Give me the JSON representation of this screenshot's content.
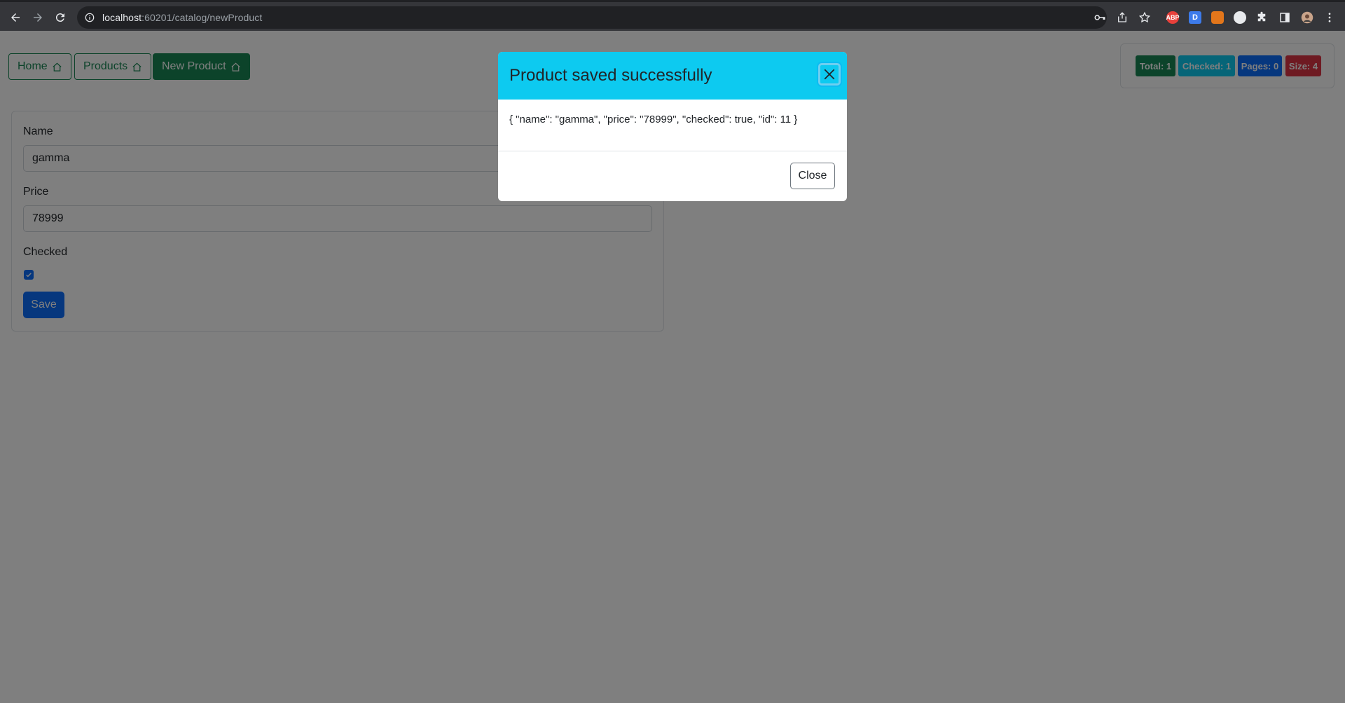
{
  "browser": {
    "url_host": "localhost",
    "url_rest": ":60201/catalog/newProduct",
    "extensions": [
      {
        "name": "abp-icon",
        "label": "ABP",
        "color": "#e8403b"
      },
      {
        "name": "dashlane-icon",
        "label": "D",
        "color": "#3d7bea"
      },
      {
        "name": "metamask-icon",
        "label": "",
        "color": "#e2761b"
      },
      {
        "name": "circle-extension-icon",
        "label": "",
        "color": "#e8eaed"
      }
    ]
  },
  "nav": {
    "home_label": "Home",
    "products_label": "Products",
    "new_product_label": "New Product"
  },
  "badges": {
    "total": "Total: 1",
    "checked": "Checked: 1",
    "pages": "Pages: 0",
    "size": "Size: 4"
  },
  "form": {
    "name_label": "Name",
    "name_value": "gamma",
    "price_label": "Price",
    "price_value": "78999",
    "checked_label": "Checked",
    "checked_value": true,
    "save_label": "Save"
  },
  "modal": {
    "title": "Product saved successfully",
    "body": "{ \"name\": \"gamma\", \"price\": \"78999\", \"checked\": true, \"id\": 11 }",
    "close_label": "Close"
  },
  "colors": {
    "success": "#198754",
    "info": "#0dcaf0",
    "primary": "#0d6efd",
    "danger": "#dc3545"
  }
}
